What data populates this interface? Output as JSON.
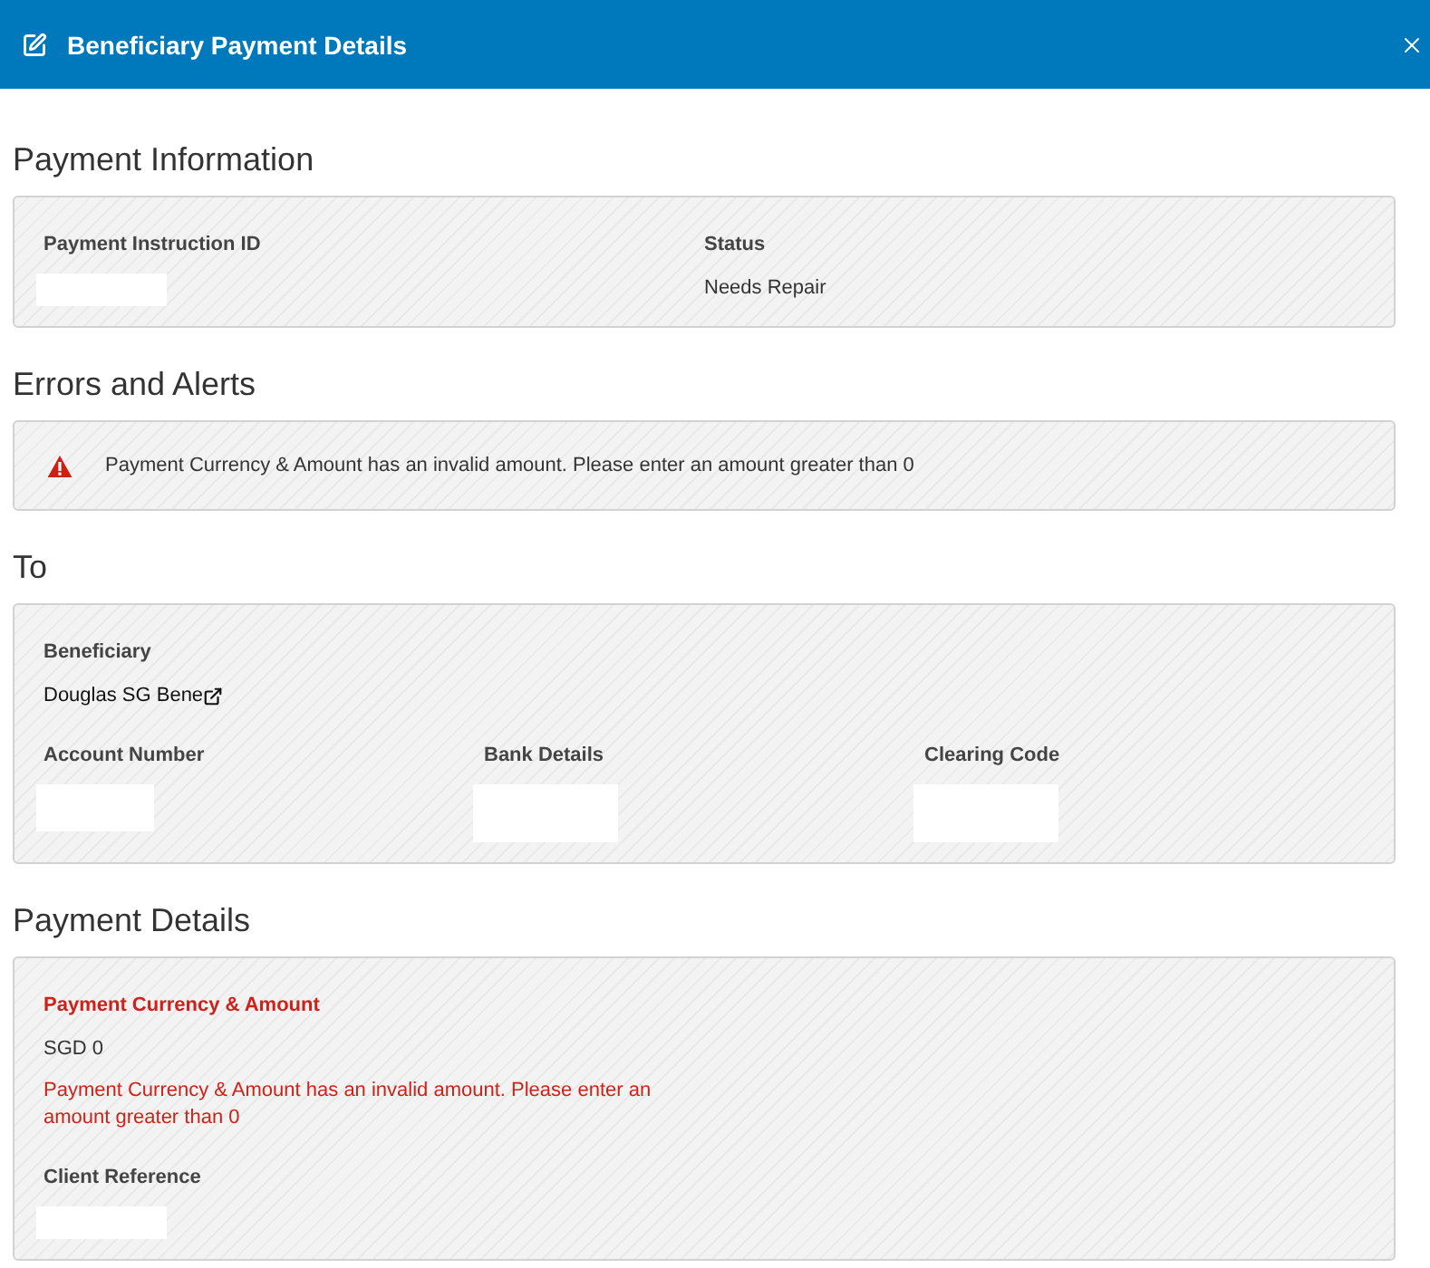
{
  "header": {
    "title": "Beneficiary Payment Details"
  },
  "sections": [
    {
      "kind": "fields",
      "title": "Payment Information",
      "rows": [
        [
          {
            "kind": "redacted",
            "label": "Payment Instruction ID"
          },
          {
            "kind": "text",
            "label": "Status",
            "value": "Needs Repair"
          }
        ]
      ]
    },
    {
      "kind": "alerts",
      "title": "Errors and Alerts",
      "alerts": [
        {
          "kind": "error",
          "message": "Payment Currency & Amount has an invalid amount. Please enter an amount greater than 0"
        }
      ]
    },
    {
      "kind": "fields",
      "title": "To",
      "rows": [
        [
          {
            "kind": "link",
            "label": "Beneficiary",
            "value": "Douglas SG Bene"
          }
        ],
        [
          {
            "kind": "redacted",
            "label": "Account Number"
          },
          {
            "kind": "redacted",
            "label": "Bank Details"
          },
          {
            "kind": "redacted",
            "label": "Clearing Code"
          }
        ]
      ]
    },
    {
      "kind": "fields",
      "title": "Payment Details",
      "rows": [
        [
          {
            "kind": "text",
            "label": "Payment Currency & Amount",
            "value": "SGD 0",
            "invalid": true,
            "error": "Payment Currency & Amount has an invalid amount. Please enter an amount greater than 0"
          }
        ],
        [
          {
            "kind": "redacted",
            "label": "Client Reference",
            "invalid": false
          }
        ]
      ]
    }
  ]
}
